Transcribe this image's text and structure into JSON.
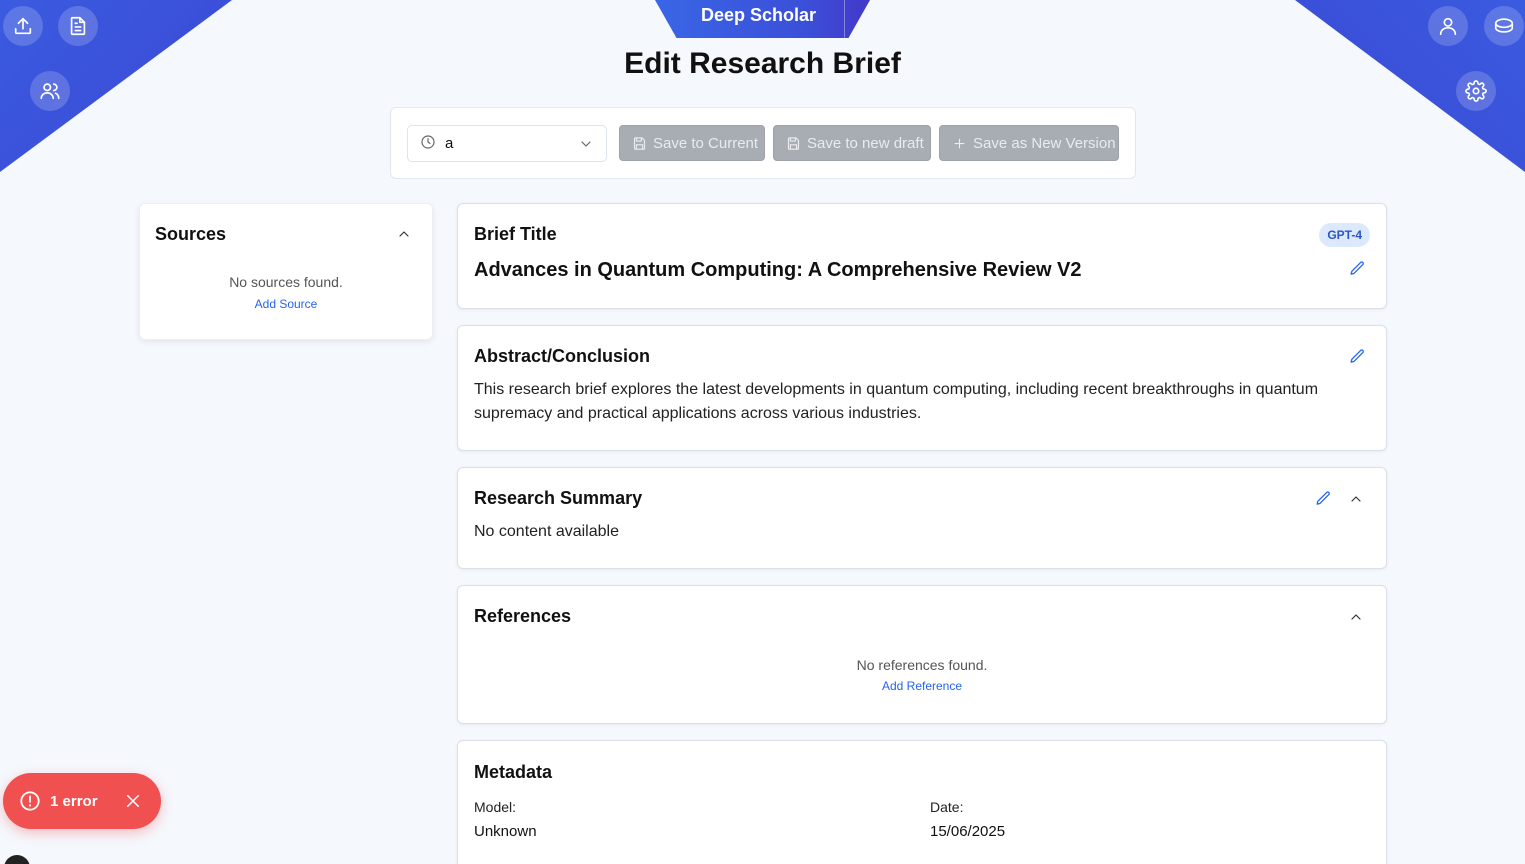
{
  "app": {
    "brand": "Deep Scholar",
    "page_title": "Edit Research Brief"
  },
  "toolbar": {
    "version_value": "a",
    "save_current_label": "Save to Current",
    "save_draft_label": "Save to new draft",
    "save_version_label": "Save as New Version"
  },
  "sources": {
    "title": "Sources",
    "empty": "No sources found.",
    "add_label": "Add Source"
  },
  "brief": {
    "section_label": "Brief Title",
    "model_badge": "GPT-4",
    "title": "Advances in Quantum Computing: A Comprehensive Review V2"
  },
  "abstract": {
    "title": "Abstract/Conclusion",
    "body": "This research brief explores the latest developments in quantum computing, including recent breakthroughs in quantum supremacy and practical applications across various industries."
  },
  "summary": {
    "title": "Research Summary",
    "body": "No content available"
  },
  "references": {
    "title": "References",
    "empty": "No references found.",
    "add_label": "Add Reference"
  },
  "metadata": {
    "title": "Metadata",
    "model_label": "Model:",
    "model_value": "Unknown",
    "date_label": "Date:",
    "date_value": "15/06/2025"
  },
  "toast": {
    "message": "1 error"
  },
  "colors": {
    "accent": "#2563eb",
    "brand_blue": "#3b4fd8",
    "error": "#f0504f",
    "disabled_button": "#a8acb3"
  }
}
